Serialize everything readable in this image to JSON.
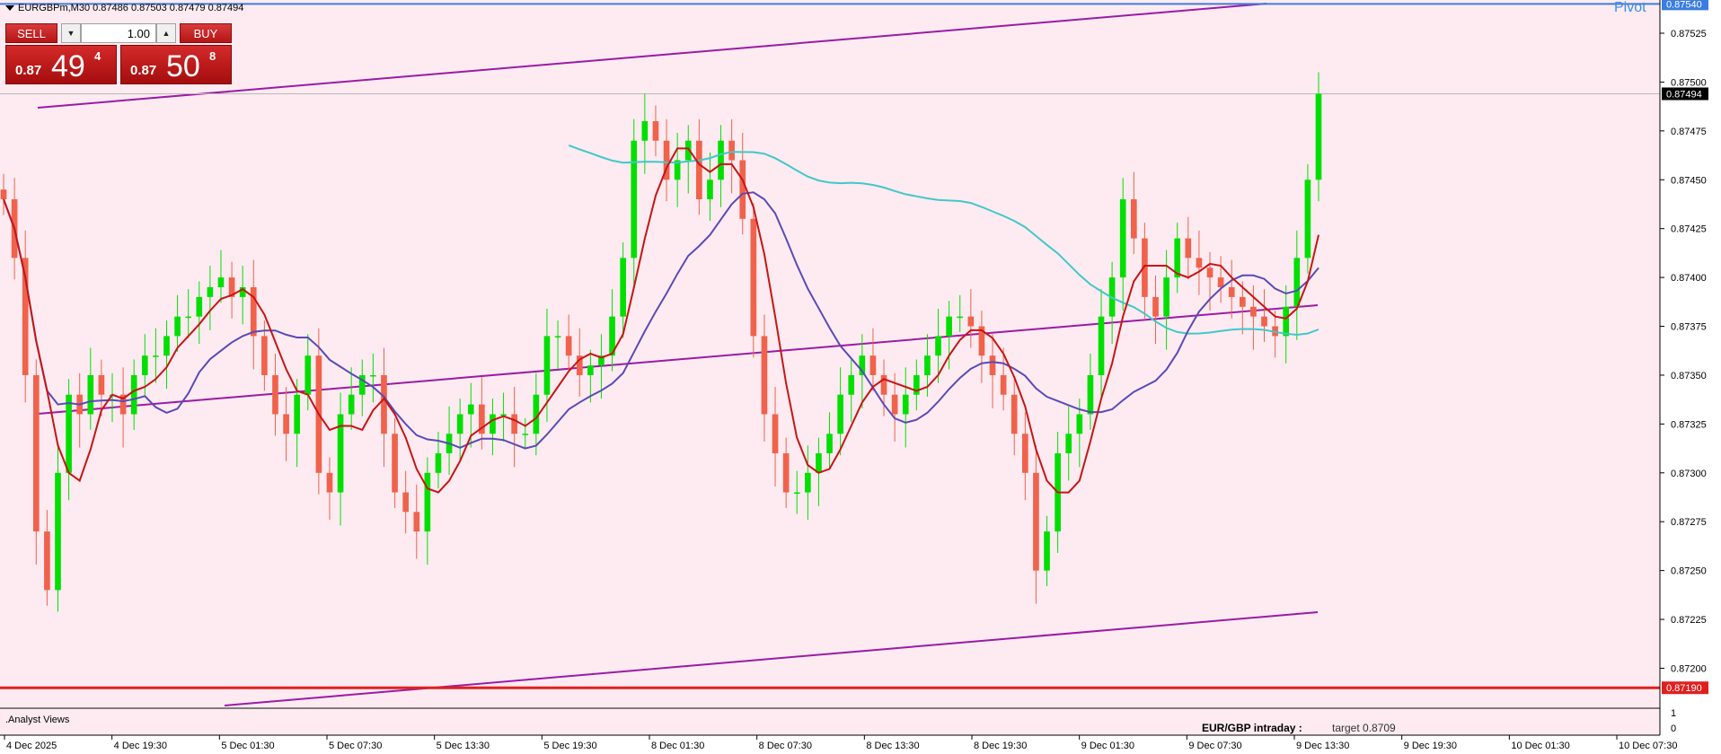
{
  "header": {
    "symbol_info": "EURGBPm,M30  0.87486 0.87503 0.87479 0.87494",
    "pivot_label": "Pivot",
    "indicator_window_label": ".Analyst Views",
    "bottom_title": "EUR/GBP intraday :",
    "bottom_target": "target 0.8709"
  },
  "trade_panel": {
    "sell_label": "SELL",
    "buy_label": "BUY",
    "volume": "1.00",
    "sell_small": "0.87",
    "sell_big": "49",
    "sell_sup": "4",
    "buy_small": "0.87",
    "buy_big": "50",
    "buy_sup": "8"
  },
  "colors": {
    "background": "#fdebf1",
    "bull": "#00e000",
    "bear": "#f0624b",
    "ma_fast": "#c81414",
    "ma_slow": "#5a4ab8",
    "ma_cyan": "#40c8c8",
    "channel": "#9b1aa6",
    "current_price_line": "#b9b9b9",
    "support_line": "#e02020",
    "pivot_line": "#3b7de0"
  },
  "chart_data": {
    "type": "candlestick",
    "symbol": "EURGBPm",
    "timeframe": "M30",
    "ylim": [
      0.8718,
      0.87542
    ],
    "y_ticks": [
      "0.87525",
      "0.87500",
      "0.87475",
      "0.87450",
      "0.87425",
      "0.87400",
      "0.87375",
      "0.87350",
      "0.87325",
      "0.87300",
      "0.87275",
      "0.87250",
      "0.87225",
      "0.87200"
    ],
    "price_tags": {
      "pivot": "0.87540",
      "current": "0.87494",
      "support": "0.87190"
    },
    "levels": {
      "pivot": 0.8754,
      "current": 0.87494,
      "support": 0.8719
    },
    "x_labels": [
      "4 Dec 2025",
      "4 Dec 19:30",
      "5 Dec 01:30",
      "5 Dec 07:30",
      "5 Dec 13:30",
      "5 Dec 19:30",
      "8 Dec 01:30",
      "8 Dec 07:30",
      "8 Dec 13:30",
      "8 Dec 19:30",
      "9 Dec 01:30",
      "9 Dec 07:30",
      "9 Dec 13:30",
      "9 Dec 19:30",
      "10 Dec 01:30",
      "10 Dec 07:30"
    ],
    "indicator_axis": [
      "1",
      "0"
    ],
    "close_series": [
      0.8744,
      0.8741,
      0.8735,
      0.8727,
      0.8724,
      0.873,
      0.8734,
      0.8733,
      0.8735,
      0.8734,
      0.8734,
      0.8733,
      0.8735,
      0.8736,
      0.8736,
      0.8737,
      0.8738,
      0.8738,
      0.8739,
      0.87395,
      0.874,
      0.8739,
      0.87395,
      0.8737,
      0.8735,
      0.8733,
      0.8732,
      0.8734,
      0.8736,
      0.873,
      0.8729,
      0.8733,
      0.8734,
      0.8735,
      0.8735,
      0.8732,
      0.8729,
      0.8728,
      0.8727,
      0.873,
      0.8731,
      0.8732,
      0.8733,
      0.87335,
      0.8732,
      0.8733,
      0.8733,
      0.8732,
      0.8732,
      0.8734,
      0.8737,
      0.8737,
      0.8736,
      0.8735,
      0.87355,
      0.8736,
      0.8738,
      0.8741,
      0.8747,
      0.8748,
      0.8747,
      0.8745,
      0.8746,
      0.8747,
      0.8744,
      0.8745,
      0.8747,
      0.8746,
      0.8743,
      0.8737,
      0.8733,
      0.8731,
      0.8729,
      0.8729,
      0.873,
      0.8731,
      0.8732,
      0.8734,
      0.8735,
      0.8736,
      0.8735,
      0.8734,
      0.8733,
      0.8734,
      0.8735,
      0.8736,
      0.8737,
      0.8738,
      0.8738,
      0.87375,
      0.8736,
      0.8735,
      0.8734,
      0.8732,
      0.873,
      0.8725,
      0.8727,
      0.8731,
      0.8732,
      0.8733,
      0.8735,
      0.8738,
      0.874,
      0.8744,
      0.8742,
      0.8739,
      0.8738,
      0.874,
      0.8742,
      0.8741,
      0.87405,
      0.874,
      0.87395,
      0.8739,
      0.87385,
      0.8738,
      0.87375,
      0.8737,
      0.87385,
      0.8741,
      0.8745,
      0.87494
    ]
  }
}
